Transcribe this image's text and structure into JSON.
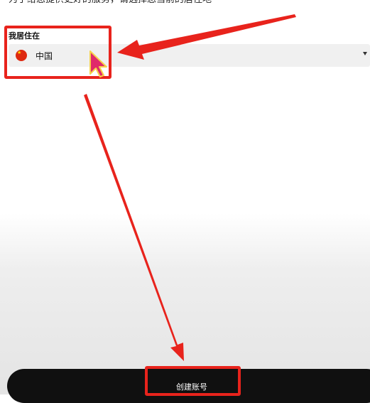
{
  "intro_text": "为了给您提供更好的服务，请选择您当前的居住地",
  "residence": {
    "label": "我居住在",
    "selected_value": "中国",
    "flag_icon": "china-flag-icon",
    "caret_icon": "caret-down-icon"
  },
  "create_button": {
    "label": "创建账号"
  },
  "annotation_color": "#e8231c"
}
